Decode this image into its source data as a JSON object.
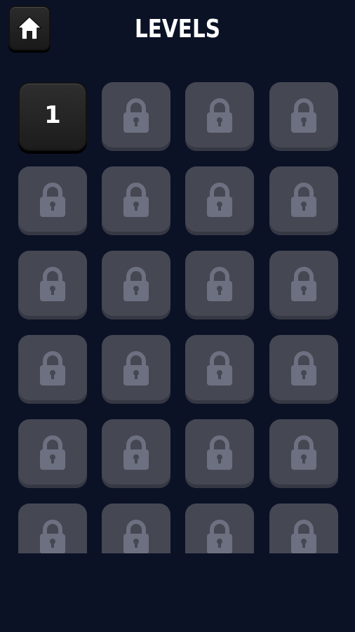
{
  "header": {
    "title": "LEVELS",
    "home_icon": "home-icon"
  },
  "levels": {
    "columns": 4,
    "unlocked": [
      "1"
    ],
    "locked_icon": "lock-icon",
    "locked_count_visible": 23
  },
  "colors": {
    "background": "#0b1226",
    "tile_locked": "#454753",
    "lock_icon": "#6d7080",
    "tile_unlocked": "#1f1f1f",
    "text": "#ffffff"
  }
}
